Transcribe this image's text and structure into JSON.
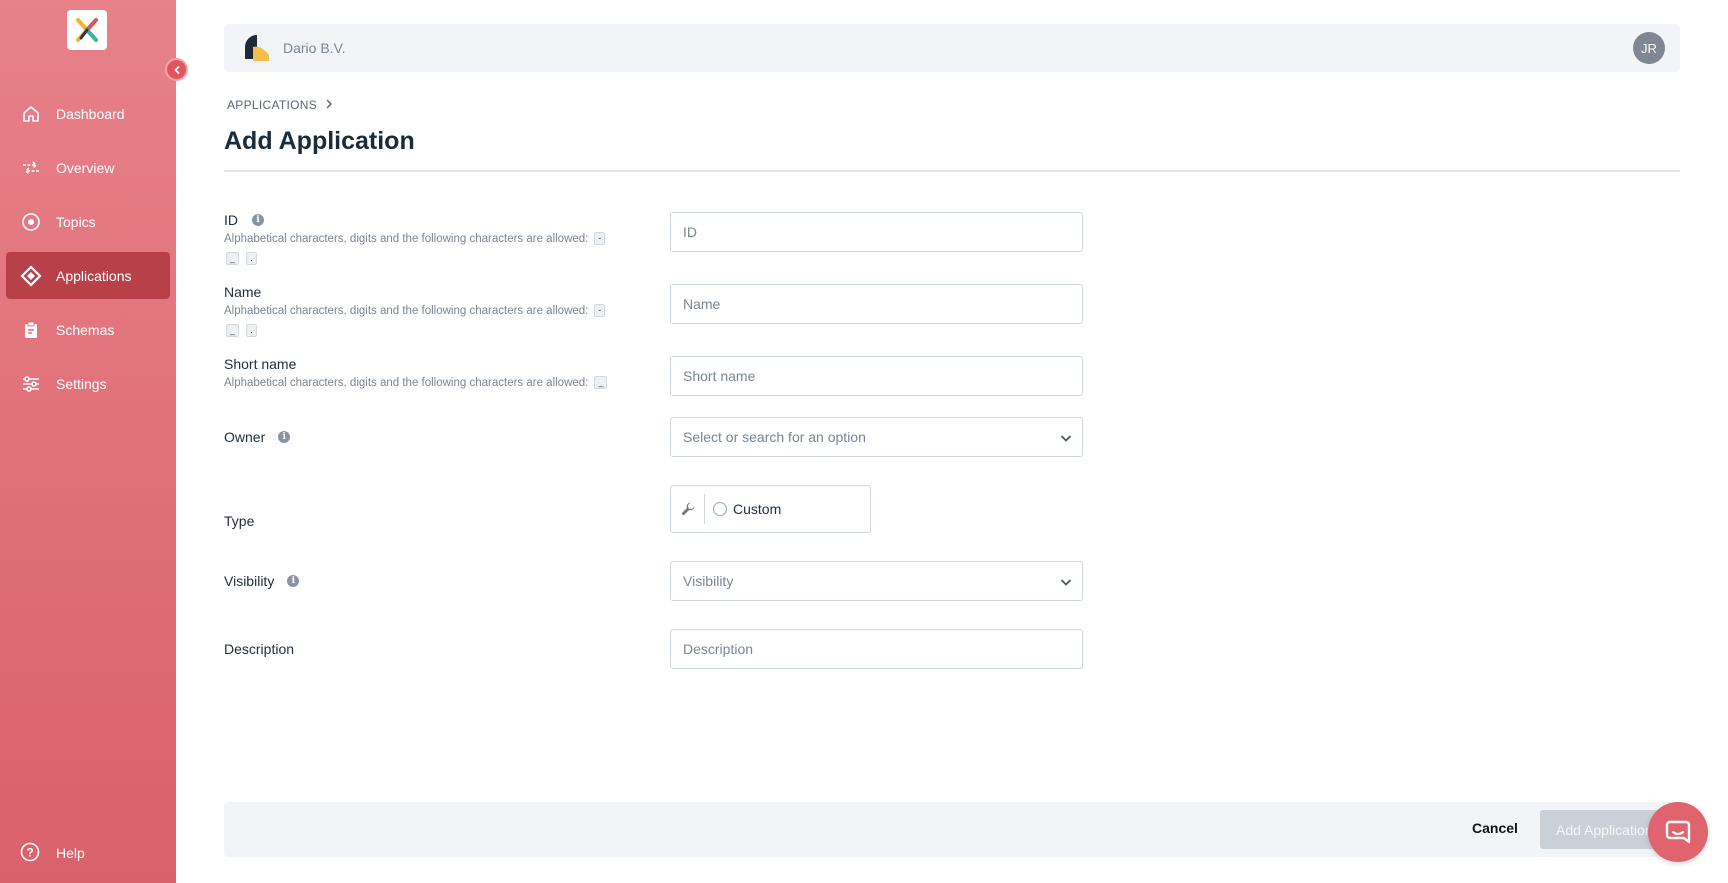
{
  "sidebar": {
    "items": [
      {
        "label": "Dashboard",
        "icon": "home-icon"
      },
      {
        "label": "Overview",
        "icon": "arrows-icon"
      },
      {
        "label": "Topics",
        "icon": "target-icon"
      },
      {
        "label": "Applications",
        "icon": "diamond-icon",
        "active": true
      },
      {
        "label": "Schemas",
        "icon": "clipboard-icon"
      },
      {
        "label": "Settings",
        "icon": "sliders-icon"
      }
    ],
    "help_label": "Help"
  },
  "header": {
    "org_name": "Dario B.V.",
    "avatar_initials": "JR"
  },
  "breadcrumb": {
    "root": "APPLICATIONS"
  },
  "page": {
    "title": "Add Application"
  },
  "form": {
    "id": {
      "label": "ID",
      "hint": "Alphabetical characters, digits and the following characters are allowed:",
      "allowed": [
        "-",
        "_",
        "."
      ],
      "placeholder": "ID"
    },
    "name": {
      "label": "Name",
      "hint": "Alphabetical characters, digits and the following characters are allowed:",
      "allowed": [
        "-",
        "_",
        "."
      ],
      "placeholder": "Name"
    },
    "short_name": {
      "label": "Short name",
      "hint": "Alphabetical characters, digits and the following characters are allowed:",
      "allowed": [
        "_"
      ],
      "placeholder": "Short name"
    },
    "owner": {
      "label": "Owner",
      "placeholder": "Select or search for an option"
    },
    "type": {
      "label": "Type",
      "option": "Custom"
    },
    "visibility": {
      "label": "Visibility",
      "placeholder": "Visibility"
    },
    "description": {
      "label": "Description",
      "placeholder": "Description"
    }
  },
  "footer": {
    "cancel_label": "Cancel",
    "submit_label": "Add Application"
  },
  "colors": {
    "sidebar_top": "#e8818a",
    "sidebar_bottom": "#d9616b",
    "sidebar_active": "#b84049",
    "accent": "#e0646d"
  }
}
